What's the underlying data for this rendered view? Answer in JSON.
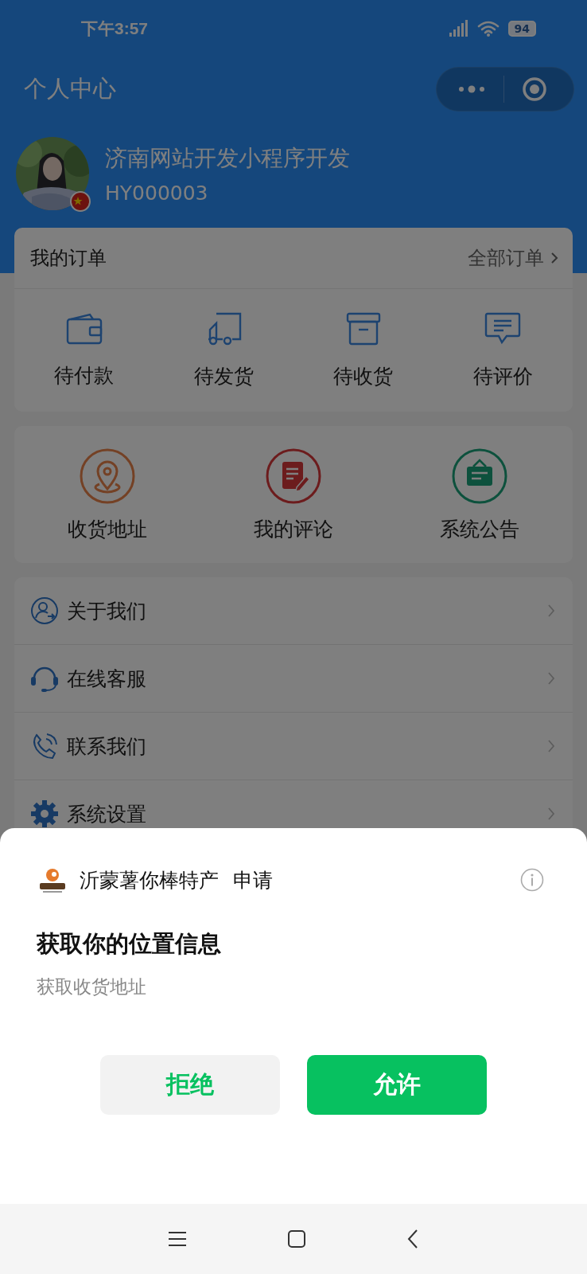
{
  "status_bar": {
    "time": "下午3:57",
    "battery": "94"
  },
  "header": {
    "title": "个人中心"
  },
  "profile": {
    "name": "济南网站开发小程序开发",
    "member_id": "HY000003"
  },
  "orders": {
    "title": "我的订单",
    "all_link": "全部订单",
    "items": [
      {
        "label": "待付款",
        "kind": "wallet"
      },
      {
        "label": "待发货",
        "kind": "truck"
      },
      {
        "label": "待收货",
        "kind": "box"
      },
      {
        "label": "待评价",
        "kind": "comment"
      }
    ]
  },
  "services": {
    "items": [
      {
        "label": "收货地址",
        "kind": "location"
      },
      {
        "label": "我的评论",
        "kind": "review"
      },
      {
        "label": "系统公告",
        "kind": "notice"
      }
    ]
  },
  "menu": {
    "items": [
      {
        "label": "关于我们",
        "kind": "about"
      },
      {
        "label": "在线客服",
        "kind": "support"
      },
      {
        "label": "联系我们",
        "kind": "phone"
      },
      {
        "label": "系统设置",
        "kind": "settings"
      }
    ]
  },
  "permission_sheet": {
    "app_name": "沂蒙薯你棒特产",
    "action": "申请",
    "title": "获取你的位置信息",
    "description": "获取收货地址",
    "buttons": [
      {
        "label": "拒绝",
        "kind": "reject"
      },
      {
        "label": "允许",
        "kind": "allow"
      }
    ]
  }
}
